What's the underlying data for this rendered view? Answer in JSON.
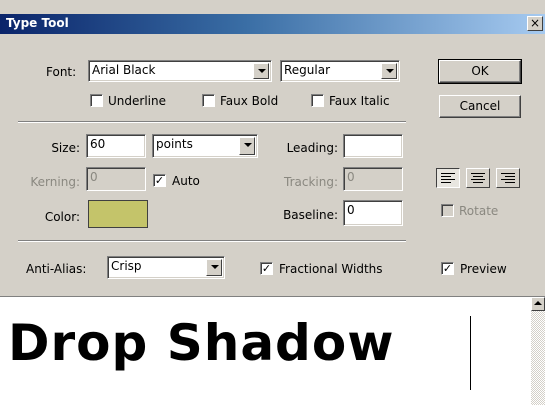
{
  "window": {
    "title": "Type Tool",
    "close_glyph": "×"
  },
  "font": {
    "label": "Font:",
    "family_value": "Arial Black",
    "style_value": "Regular",
    "underline_label": "Underline",
    "underline_checked": false,
    "faux_bold_label": "Faux Bold",
    "faux_bold_checked": false,
    "faux_italic_label": "Faux Italic",
    "faux_italic_checked": false
  },
  "buttons": {
    "ok_label": "OK",
    "cancel_label": "Cancel"
  },
  "size": {
    "label": "Size:",
    "value": "60",
    "unit": "points"
  },
  "leading": {
    "label": "Leading:",
    "value": ""
  },
  "kerning": {
    "label": "Kerning:",
    "value": "0",
    "auto_label": "Auto",
    "auto_checked": true
  },
  "tracking": {
    "label": "Tracking:",
    "value": "0"
  },
  "color": {
    "label": "Color:",
    "swatch": "#c4c46a"
  },
  "baseline": {
    "label": "Baseline:",
    "value": "0"
  },
  "alignment": {
    "left_icon": "align-left-icon",
    "center_icon": "align-center-icon",
    "right_icon": "align-right-icon"
  },
  "rotate": {
    "label": "Rotate",
    "checked": false
  },
  "antialias": {
    "label": "Anti-Alias:",
    "value": "Crisp"
  },
  "fractional_widths": {
    "label": "Fractional Widths",
    "checked": true
  },
  "preview": {
    "label": "Preview",
    "checked": true
  },
  "text_area": {
    "content": "Drop Shadow"
  },
  "colors": {
    "dialog_bg": "#d4d0c8",
    "title_start": "#0a246a",
    "title_end": "#a6caf0"
  }
}
